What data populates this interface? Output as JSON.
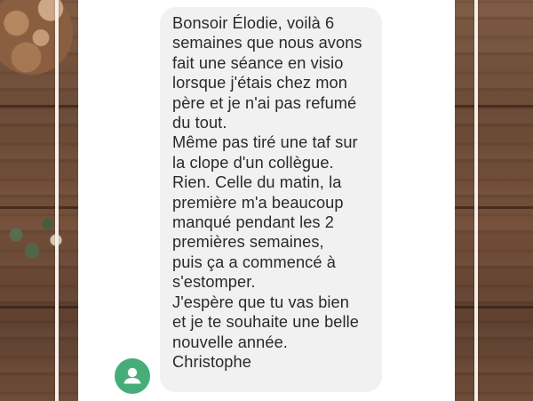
{
  "message": {
    "lines": [
      "Bonsoir Élodie, voilà 6",
      "semaines que nous avons",
      "fait une séance en visio",
      "lorsque j'étais chez mon",
      "père et je n'ai pas refumé",
      "du tout.",
      "Même pas tiré une taf sur",
      "la clope d'un collègue.",
      "Rien. Celle du matin, la",
      "première m'a beaucoup",
      "manqué pendant les 2",
      "premières semaines,",
      "puis ça a commencé à",
      "s'estomper.",
      "J'espère que tu vas bien",
      "et je te souhaite une belle",
      "nouvelle année.",
      "Christophe"
    ]
  },
  "sender": {
    "avatar_icon": "person-icon",
    "avatar_color": "#46ad79"
  },
  "colors": {
    "bubble": "#f1f1f1",
    "text": "#2a2a2a"
  }
}
